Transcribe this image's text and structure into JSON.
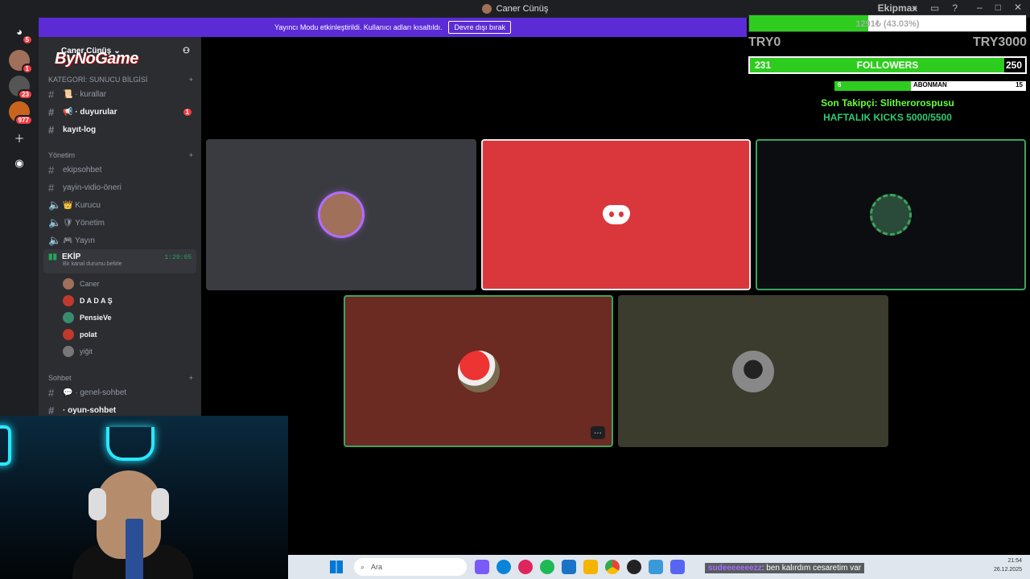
{
  "window": {
    "title": "Caner Cünüş",
    "overlay_top_label": "Ekipmax"
  },
  "rail": {
    "servers": [
      {
        "icon": "discord-home-icon",
        "badge": "5"
      },
      {
        "icon": "server-avatar",
        "badge": "1"
      },
      {
        "icon": "server-avatar",
        "badge": "23"
      },
      {
        "icon": "server-avatar",
        "badge": "977"
      },
      {
        "icon": "add-server-icon",
        "badge": ""
      },
      {
        "icon": "explore-icon",
        "badge": ""
      }
    ]
  },
  "modebar": {
    "text": "Yayıncı Modu etkinleştirildi. Kullanıcı adları kısaltıldı.",
    "button": "Devre dışı bırak"
  },
  "sidebar": {
    "server_name": "Caner Cünüş",
    "logo_text": "ByNoGame",
    "categories": [
      {
        "label": "KATEGORİ: SUNUCU BİLGİSİ"
      },
      {
        "label": "Yönetim"
      },
      {
        "label": "Sohbet"
      }
    ],
    "info_channels": [
      {
        "name": "📜 · kurallar",
        "bold": false,
        "badge": ""
      },
      {
        "name": "📢 · duyurular",
        "bold": true,
        "badge": "1"
      },
      {
        "name": "kayıt-log",
        "bold": true,
        "badge": ""
      }
    ],
    "mgmt_channels": [
      {
        "name": "ekipsohbet",
        "type": "text"
      },
      {
        "name": "yayin-vidio-öneri",
        "type": "text"
      },
      {
        "name": "👑 Kurucu",
        "type": "voice"
      },
      {
        "name": "🛡 Yönetim",
        "type": "voice"
      },
      {
        "name": "🎮 Yayın",
        "type": "voice"
      }
    ],
    "active_voice": {
      "name": "EKİP",
      "time": "1:29:05",
      "status": "Bir kanal durumu belirle"
    },
    "members": [
      {
        "name": "Caner",
        "online": false,
        "color": "#a0705a"
      },
      {
        "name": "D A D A Ş",
        "online": true,
        "color": "#c0392b"
      },
      {
        "name": "PensieVe",
        "online": true,
        "color": "#3a8a6e"
      },
      {
        "name": "polat",
        "online": true,
        "color": "#c0392b"
      },
      {
        "name": "yiğit",
        "online": false,
        "color": "#777"
      }
    ],
    "chat_channels": [
      {
        "name": "💬 · genel-sohbet"
      },
      {
        "name": "· oyun-sohbet"
      }
    ]
  },
  "overlay": {
    "goal_text": "1291₺ (43.03%)",
    "goal_progress": 0.4303,
    "range_min": "TRY0",
    "range_max": "TRY3000",
    "followers_current": "231",
    "followers_label": "FOLLOWERS",
    "followers_target": "250",
    "followers_progress": 0.924,
    "subs_current": "6",
    "subs_label": "ABONMAN",
    "subs_target": "15",
    "subs_progress": 0.4,
    "last_follower": "Son Takipçi: Slitherorospusu",
    "weekly_kicks": "HAFTALIK KICKS 5000/5500"
  },
  "tiles": [
    {
      "name": "tile-caner",
      "bg": "#3a3b40",
      "border": "#3a3b40"
    },
    {
      "name": "tile-dadas",
      "bg": "#da373c",
      "border": "#e8e8e8"
    },
    {
      "name": "tile-pensieve",
      "bg": "#0c0d10",
      "border": "#3ba55d"
    },
    {
      "name": "tile-polat",
      "bg": "#6b2a22",
      "border": "#3ba55d"
    },
    {
      "name": "tile-yigit",
      "bg": "#3b3b2e",
      "border": "#3b3b2e"
    }
  ],
  "taskbar": {
    "search_placeholder": "Ara",
    "time": "21:54",
    "date": "26.12.2025"
  },
  "stream_chat": {
    "user": "sudeeeeeeezz",
    "message": ": ben kalırdım cesaretim var"
  },
  "colors": {
    "accent": "#5b2bd6",
    "green": "#2ecc1f",
    "discord_red": "#da373c"
  }
}
